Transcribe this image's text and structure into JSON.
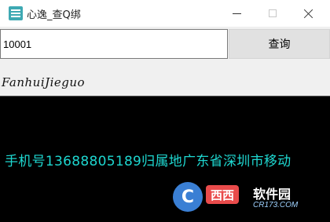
{
  "window": {
    "title": "心逸_查Q绑",
    "icon": "app-icon"
  },
  "search": {
    "value": "10001",
    "button_label": "查询"
  },
  "result": {
    "label": "FanhuiJieguo",
    "text": "手机号13688805189归属地广东省深圳市移动"
  },
  "watermark": {
    "badge": "西西",
    "name": "软件园",
    "domain": "CR173.COM",
    "glyph": "C"
  },
  "colors": {
    "result_text": "#1ed7d0",
    "result_background": "#000000"
  }
}
